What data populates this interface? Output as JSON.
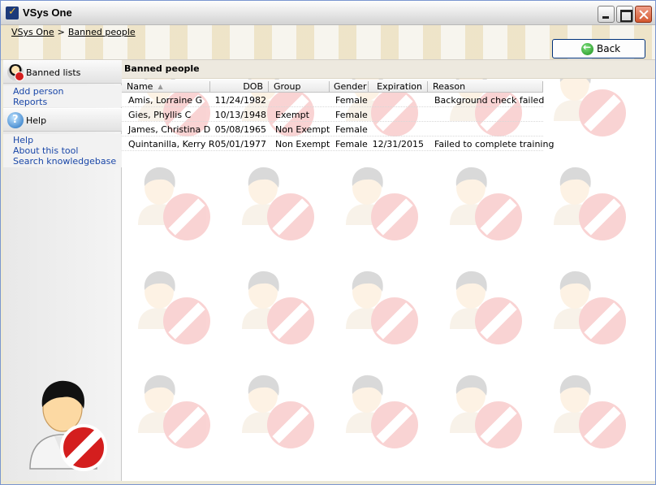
{
  "window": {
    "title": "VSys One"
  },
  "breadcrumb": {
    "root": "VSys One",
    "separator": ">",
    "current": "Banned people"
  },
  "toolbar": {
    "back_label": "Back"
  },
  "sidebar": {
    "section1": {
      "title": "Banned lists",
      "links": [
        "Add person",
        "Reports"
      ]
    },
    "section2": {
      "title": "Help",
      "links": [
        "Help",
        "About this tool",
        "Search knowledgebase"
      ]
    }
  },
  "main": {
    "title": "Banned people",
    "columns": [
      "Name",
      "DOB",
      "Group",
      "Gender",
      "Expiration",
      "Reason"
    ],
    "sort": {
      "column": "Name",
      "direction": "ascending"
    },
    "rows": [
      [
        "Amis, Lorraine G",
        "11/24/1982",
        "",
        "Female",
        "",
        "Background check failed"
      ],
      [
        "Gies, Phyllis C",
        "10/13/1948",
        "Exempt",
        "Female",
        "",
        ""
      ],
      [
        "James, Christina D",
        "05/08/1965",
        "Non Exempt",
        "Female",
        "",
        ""
      ],
      [
        "Quintanilla, Kerry R",
        "05/01/1977",
        "Non Exempt",
        "Female",
        "12/31/2015",
        "Failed to complete training"
      ]
    ]
  },
  "colors": {
    "link": "#1a47a8",
    "ban_red": "#d41e1e",
    "header_bg": "#ede9df"
  }
}
